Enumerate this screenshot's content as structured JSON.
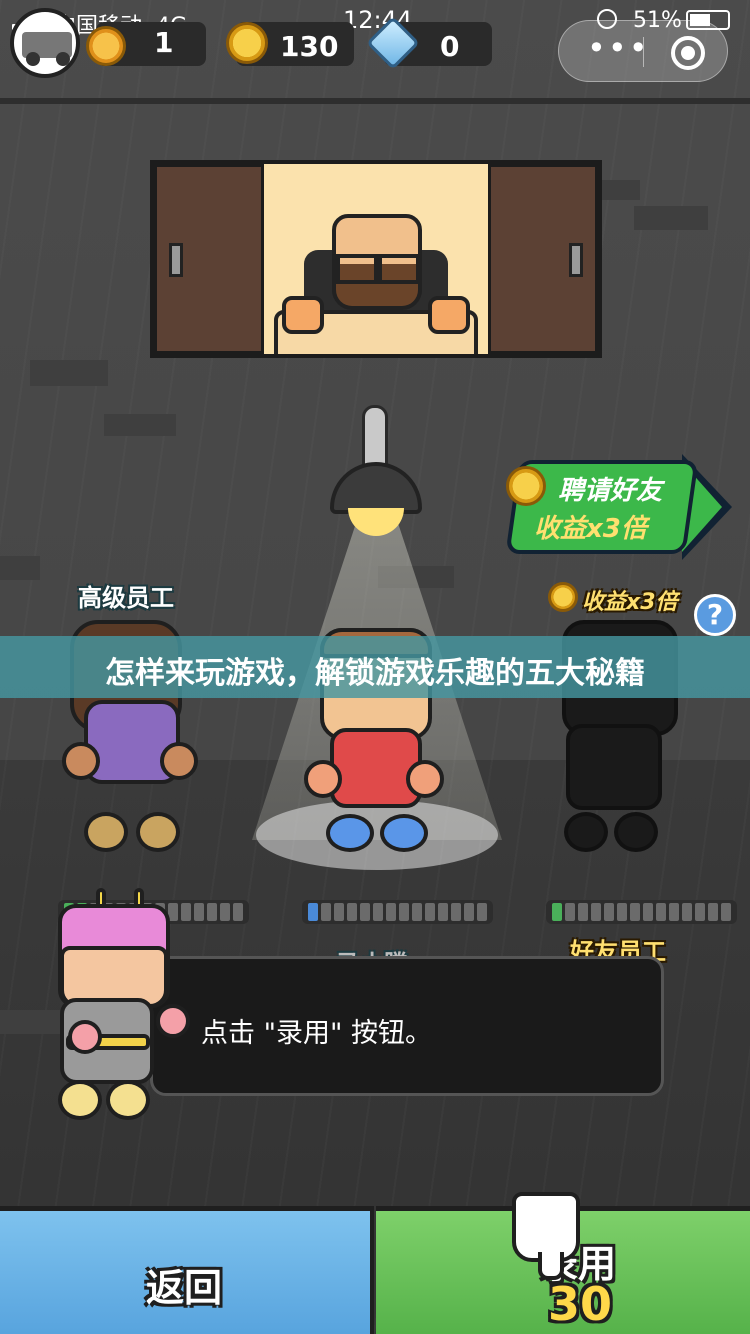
{
  "status_bar": {
    "carrier": "中国移动",
    "network": "4G",
    "time": "12:44",
    "battery": "51%"
  },
  "resources": {
    "cash": "1",
    "coins": "130",
    "gems": "0"
  },
  "invite_badge": {
    "line1": "聘请好友",
    "line2": "收益x3倍"
  },
  "employees": [
    {
      "label": "高级员工",
      "progress": 0.15
    },
    {
      "label": "马小腾",
      "progress": 0.07
    },
    {
      "label": "好友员工",
      "progress": 0.07
    }
  ],
  "friend_bonus": "收益x3倍",
  "help_icon": "?",
  "banner_title": "怎样来玩游戏，解锁游戏乐趣的五大秘籍",
  "dialog_text": "点击 \"录用\" 按钮。",
  "buttons": {
    "back_label": "返回",
    "hire_label": "录用",
    "hire_cost": "30"
  },
  "icons": [
    "signal-icon",
    "lock-icon",
    "battery-icon",
    "cash-icon",
    "coin-icon",
    "gem-icon",
    "more-dots-icon",
    "target-icon",
    "question-icon",
    "pointing-hand-icon"
  ],
  "colors": {
    "back_button": "#58a4de",
    "hire_button": "#56b24a",
    "banner": "#4696a0",
    "invite_badge": "#3cb84a"
  }
}
